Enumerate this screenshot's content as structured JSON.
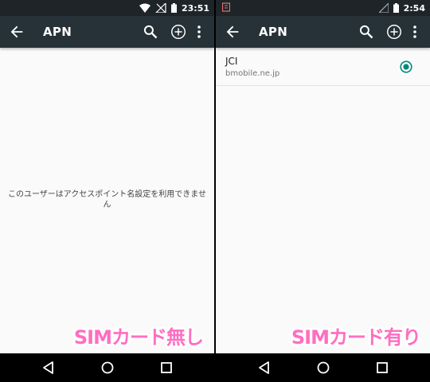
{
  "left_screen": {
    "status": {
      "time": "23:51"
    },
    "toolbar": {
      "title": "APN"
    },
    "empty_message": "このユーザーはアクセスポイント名設定を利用できません",
    "caption": "SIMカード無し"
  },
  "right_screen": {
    "status": {
      "time": "2:54"
    },
    "toolbar": {
      "title": "APN"
    },
    "apn_list": [
      {
        "name": "JCI",
        "apn": "bmobile.ne.jp",
        "selected": true
      }
    ],
    "caption": "SIMカード有り"
  },
  "icons": [
    "back-arrow-icon",
    "search-icon",
    "add-circle-icon",
    "more-vert-icon",
    "wifi-icon",
    "no-signal-icon",
    "battery-icon",
    "signal-icon",
    "notification-icon",
    "back-nav-icon",
    "home-nav-icon",
    "recents-nav-icon"
  ],
  "colors": {
    "toolbar": "#263238",
    "statusbar": "#1e2528",
    "accent": "#00897b",
    "caption": "#ff6ec0"
  }
}
